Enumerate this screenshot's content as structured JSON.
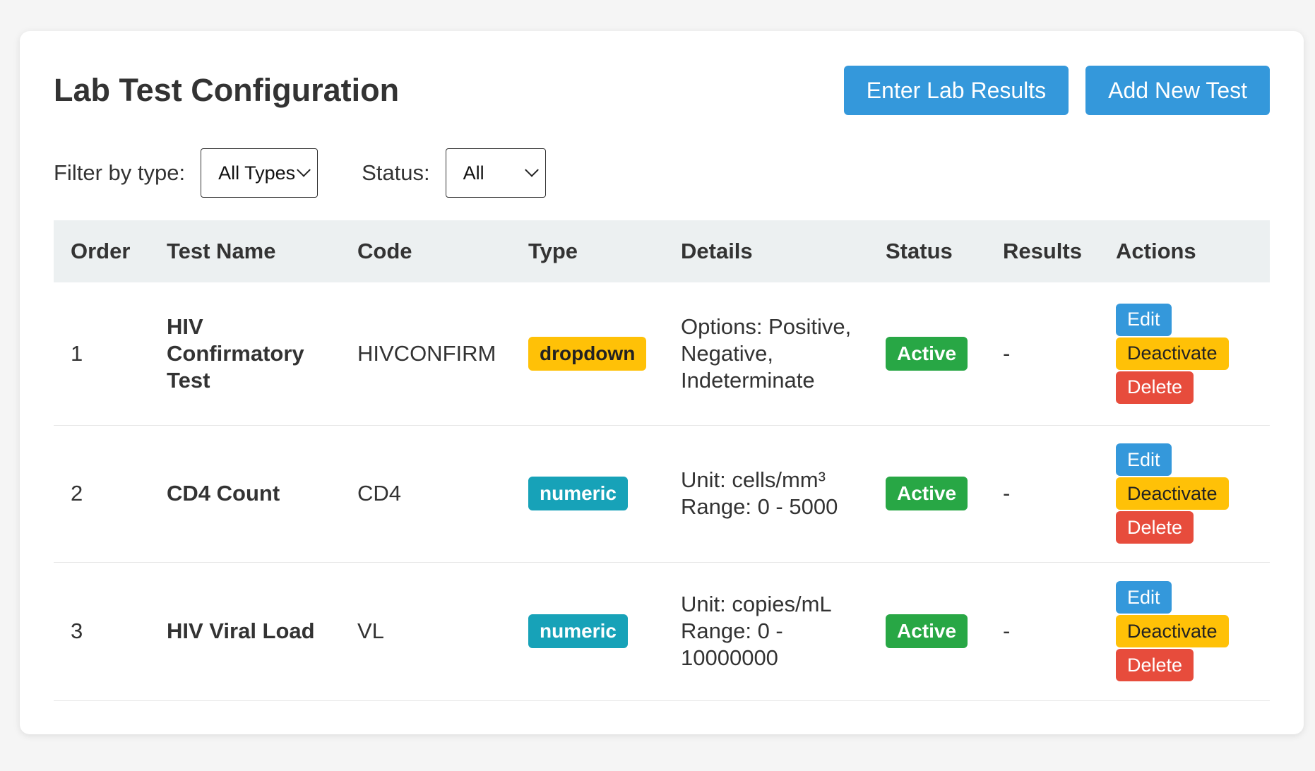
{
  "header": {
    "title": "Lab Test Configuration",
    "enter_results_label": "Enter Lab Results",
    "add_test_label": "Add New Test"
  },
  "filters": {
    "type_label": "Filter by type:",
    "type_value": "All Types",
    "status_label": "Status:",
    "status_value": "All"
  },
  "table": {
    "columns": [
      "Order",
      "Test Name",
      "Code",
      "Type",
      "Details",
      "Status",
      "Results",
      "Actions"
    ],
    "rows": [
      {
        "order": "1",
        "name": "HIV Confirmatory Test",
        "code": "HIVCONFIRM",
        "type": "dropdown",
        "details": [
          "Options: Positive, Negative, Indeterminate"
        ],
        "status": "Active",
        "results": "-"
      },
      {
        "order": "2",
        "name": "CD4 Count",
        "code": "CD4",
        "type": "numeric",
        "details": [
          "Unit: cells/mm³",
          "Range: 0 - 5000"
        ],
        "status": "Active",
        "results": "-"
      },
      {
        "order": "3",
        "name": "HIV Viral Load",
        "code": "VL",
        "type": "numeric",
        "details": [
          "Unit: copies/mL",
          "Range: 0 - 10000000"
        ],
        "status": "Active",
        "results": "-"
      }
    ],
    "actions": {
      "edit": "Edit",
      "deactivate": "Deactivate",
      "delete": "Delete"
    }
  },
  "colors": {
    "primary": "#3498db",
    "warning": "#ffc107",
    "info": "#17a2b8",
    "success": "#28a745",
    "danger": "#e74c3c",
    "header_bg": "#ecf0f1"
  },
  "icons": {
    "select_arrow": "chevron-down-icon"
  }
}
